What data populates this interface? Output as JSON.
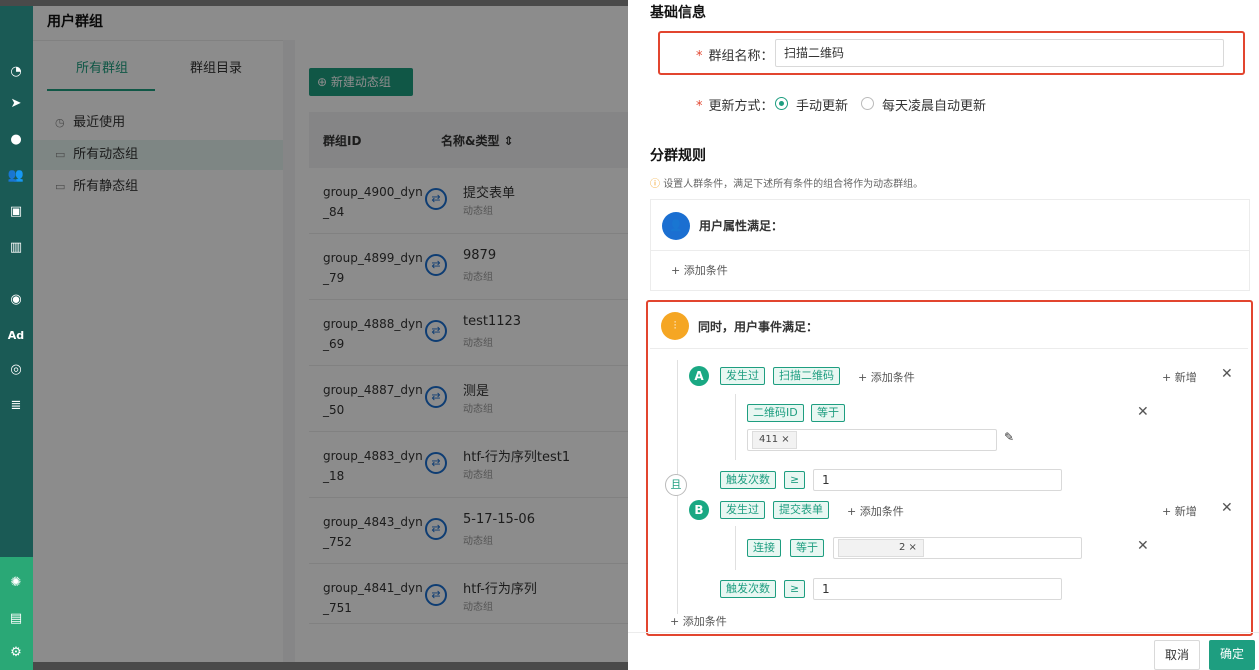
{
  "page": {
    "title": "用户群组"
  },
  "tabs": [
    {
      "label": "所有群组"
    },
    {
      "label": "群组目录"
    }
  ],
  "sidebar": [
    {
      "label": "最近使用"
    },
    {
      "label": "所有动态组"
    },
    {
      "label": "所有静态组"
    }
  ],
  "main": {
    "new_button": "新建动态组",
    "col_id": "群组ID",
    "col_name": "名称&类型 ⇕",
    "rows": [
      {
        "id": "group_4900_dyn_84",
        "name": "提交表单",
        "type": "动态组"
      },
      {
        "id": "group_4899_dyn_79",
        "name": "9879",
        "type": "动态组"
      },
      {
        "id": "group_4888_dyn_69",
        "name": "test1123",
        "type": "动态组"
      },
      {
        "id": "group_4887_dyn_50",
        "name": "测是",
        "type": "动态组"
      },
      {
        "id": "group_4883_dyn_18",
        "name": "htf-行为序列test1",
        "type": "动态组"
      },
      {
        "id": "group_4843_dyn_752",
        "name": "5-17-15-06",
        "type": "动态组"
      },
      {
        "id": "group_4841_dyn_751",
        "name": "htf-行为序列",
        "type": "动态组"
      }
    ]
  },
  "panel": {
    "basic_title": "基础信息",
    "group_name_label": "群组名称：",
    "group_name_value": "扫描二维码",
    "update_label": "更新方式：",
    "update_manual": "手动更新",
    "update_auto": "每天凌晨自动更新",
    "rules_title": "分群规则",
    "rules_tip": "设置人群条件，满足下述所有条件的组合将作为动态群组。",
    "user_attr_title": "用户属性满足：",
    "add_condition": "添加条件",
    "event_title": "同时，用户事件满足：",
    "and_label": "且",
    "add_new": "新增",
    "A": {
      "letter": "A",
      "tag1": "发生过",
      "tag2": "扫描二维码",
      "sub_tag1": "二维码ID",
      "sub_tag2": "等于",
      "chip": "411 ×",
      "trigger_label": "触发次数",
      "op": "≥",
      "count": "1"
    },
    "B": {
      "letter": "B",
      "tag1": "发生过",
      "tag2": "提交表单",
      "sub_tag1": "连接",
      "sub_tag2": "等于",
      "chip": "2 ×",
      "trigger_label": "触发次数",
      "op": "≥",
      "count": "1"
    },
    "cancel": "取消",
    "confirm": "确定"
  }
}
